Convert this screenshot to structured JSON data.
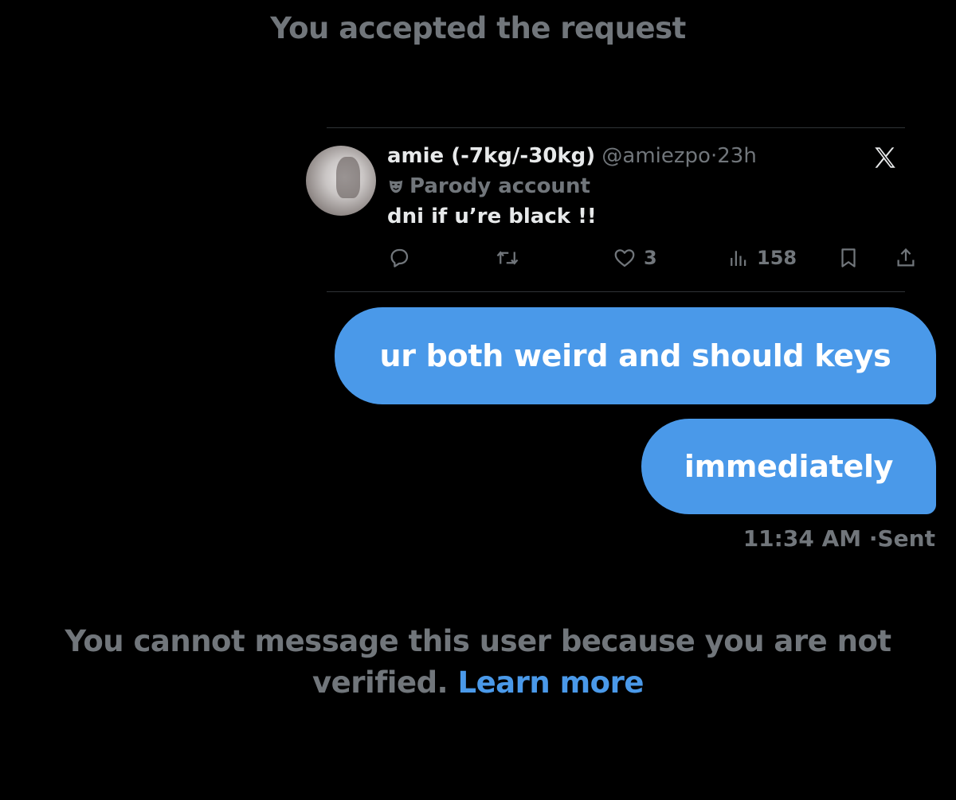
{
  "system_note": "You accepted the request",
  "tweet": {
    "author_name": "amie (-7kg/-30kg)",
    "handle": "@amiezpo",
    "separator": "·",
    "time": "23h",
    "badge_label": "Parody account",
    "text": "dni if u’re black !!",
    "likes": "3",
    "views": "158",
    "icons": [
      "reply-icon",
      "retweet-icon",
      "heart-icon",
      "analytics-icon",
      "bookmark-icon",
      "share-icon",
      "x-logo-icon",
      "parody-mask-icon"
    ]
  },
  "messages": [
    {
      "text": "ur both weird and should keys"
    },
    {
      "text": "immediately"
    }
  ],
  "message_meta": {
    "time": "11:34 AM",
    "separator": "·",
    "status": "Sent"
  },
  "footer": {
    "notice": "You cannot message this user because you are not verified.",
    "link_text": "Learn more"
  },
  "colors": {
    "background": "#000000",
    "bubble": "#4a99e9",
    "muted_text": "#71767b",
    "primary_text": "#e7e9ea",
    "link": "#4a99e9"
  }
}
